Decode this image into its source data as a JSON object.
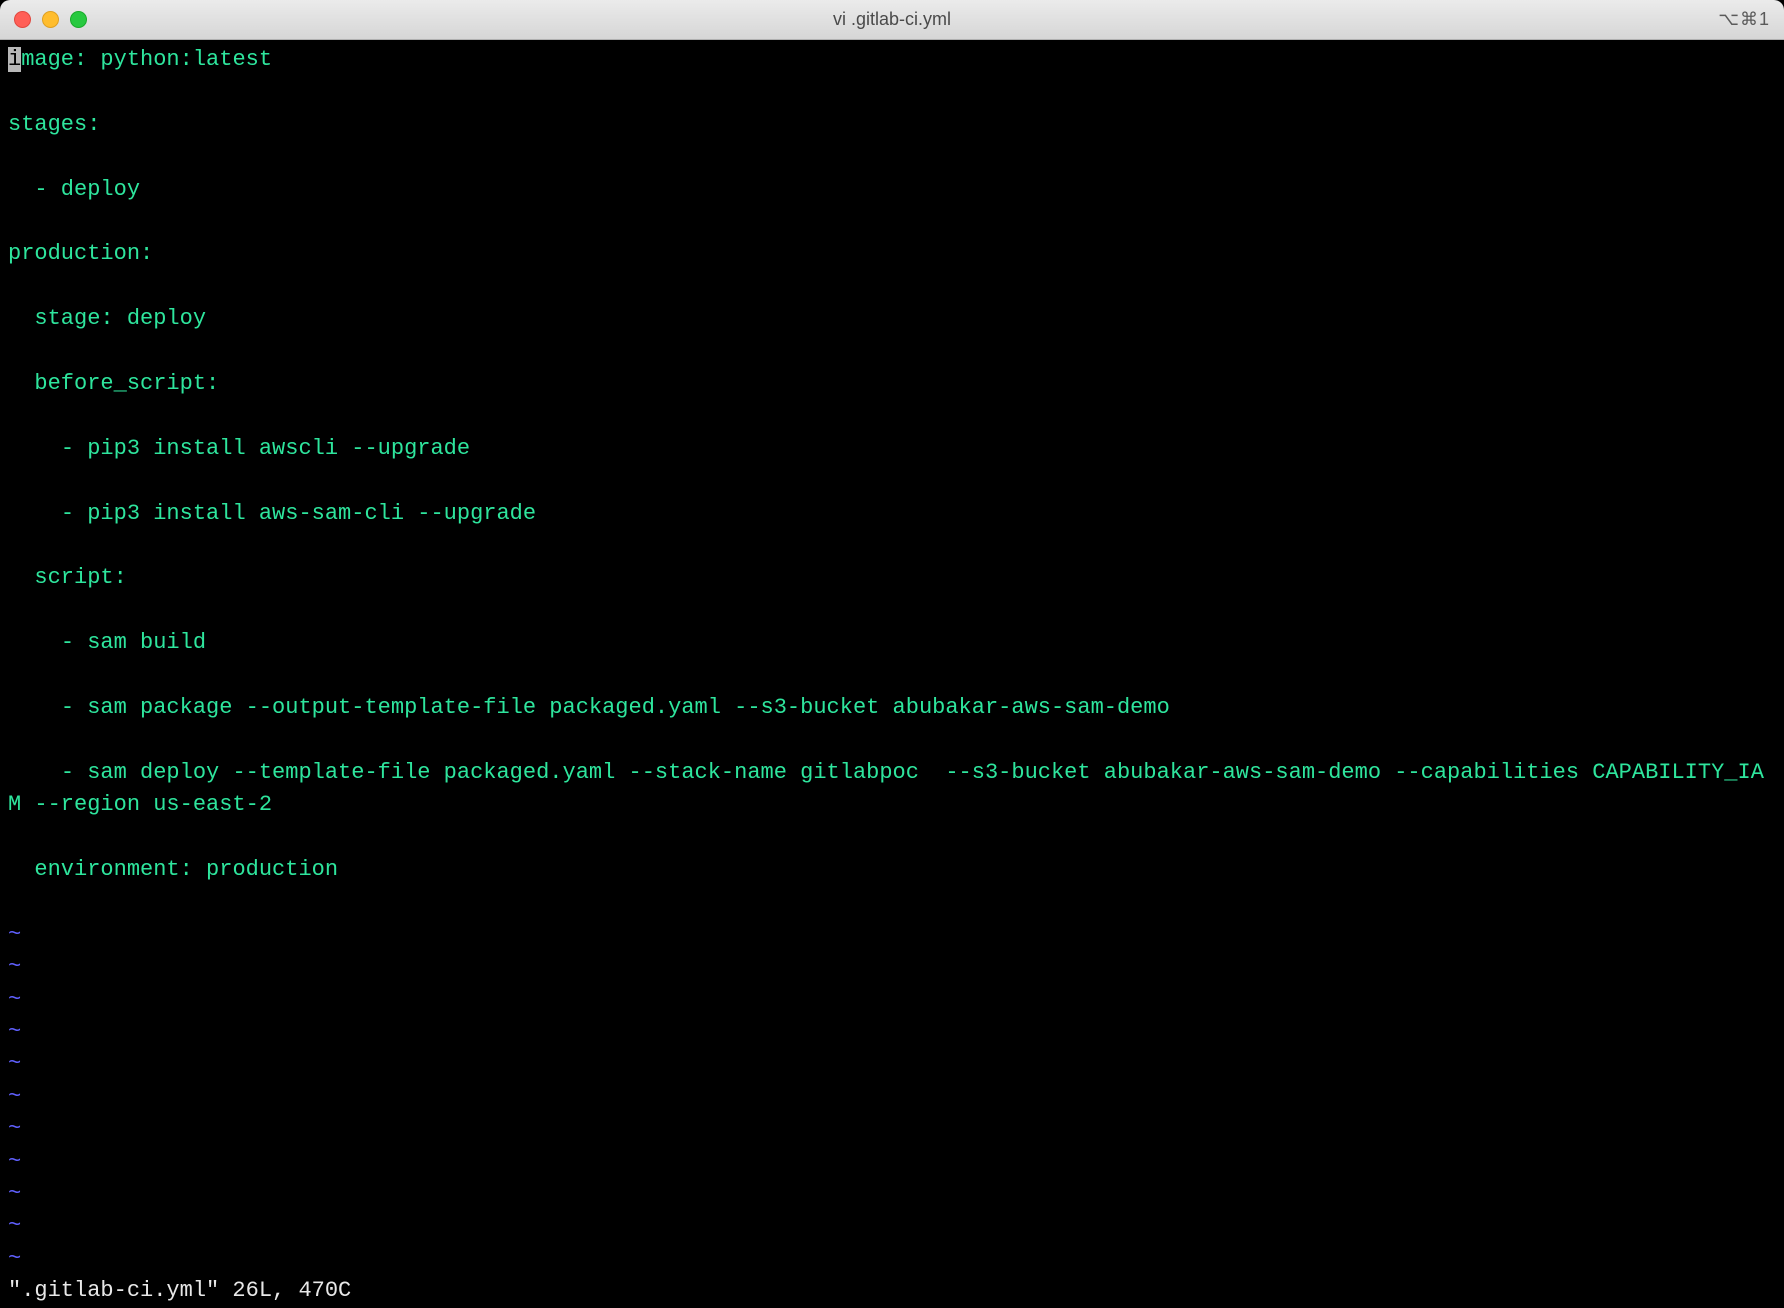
{
  "window": {
    "title": "vi .gitlab-ci.yml",
    "shortcut": "⌥⌘1"
  },
  "editor": {
    "cursor_char": "i",
    "lines": [
      "mage: python:latest",
      "",
      "stages:",
      "",
      "  - deploy",
      "",
      "production:",
      "",
      "  stage: deploy",
      "",
      "  before_script:",
      "",
      "    - pip3 install awscli --upgrade",
      "",
      "    - pip3 install aws-sam-cli --upgrade",
      "",
      "  script:",
      "",
      "    - sam build",
      "",
      "    - sam package --output-template-file packaged.yaml --s3-bucket abubakar-aws-sam-demo",
      "",
      "    - sam deploy --template-file packaged.yaml --stack-name gitlabpoc  --s3-bucket abubakar-aws-sam-demo --capabilities CAPABILITY_IAM --region us-east-2",
      "",
      "  environment: production",
      ""
    ],
    "tilde_count": 11,
    "status": "\".gitlab-ci.yml\" 26L, 470C"
  }
}
